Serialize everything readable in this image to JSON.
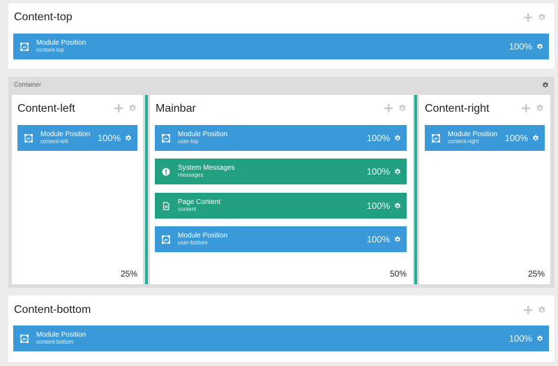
{
  "colors": {
    "blue_block": "#3a9ad9",
    "green_block": "#21a181",
    "divider": "#21b19a",
    "icon_grey": "#cccccc"
  },
  "content_top": {
    "title": "Content-top",
    "block": {
      "name": "Module Position",
      "key": "content-top",
      "width": "100%",
      "icon": "module-position-icon"
    }
  },
  "container": {
    "label": "Container",
    "columns": {
      "left": {
        "title": "Content-left",
        "size": "25%",
        "blocks": [
          {
            "name": "Module Position",
            "key": "content-left",
            "width": "100%",
            "icon": "module-position-icon"
          }
        ]
      },
      "main": {
        "title": "Mainbar",
        "size": "50%",
        "blocks": [
          {
            "name": "Module Position",
            "key": "user-top",
            "width": "100%",
            "icon": "module-position-icon"
          },
          {
            "name": "System Messages",
            "key": "messages",
            "width": "100%",
            "icon": "info-icon"
          },
          {
            "name": "Page Content",
            "key": "content",
            "width": "100%",
            "icon": "document-icon"
          },
          {
            "name": "Module Position",
            "key": "user-bottom",
            "width": "100%",
            "icon": "module-position-icon"
          }
        ]
      },
      "right": {
        "title": "Content-right",
        "size": "25%",
        "blocks": [
          {
            "name": "Module Position",
            "key": "content-right",
            "width": "100%",
            "icon": "module-position-icon"
          }
        ]
      }
    }
  },
  "content_bottom": {
    "title": "Content-bottom",
    "block": {
      "name": "Module Position",
      "key": "content-bottom",
      "width": "100%",
      "icon": "module-position-icon"
    }
  }
}
